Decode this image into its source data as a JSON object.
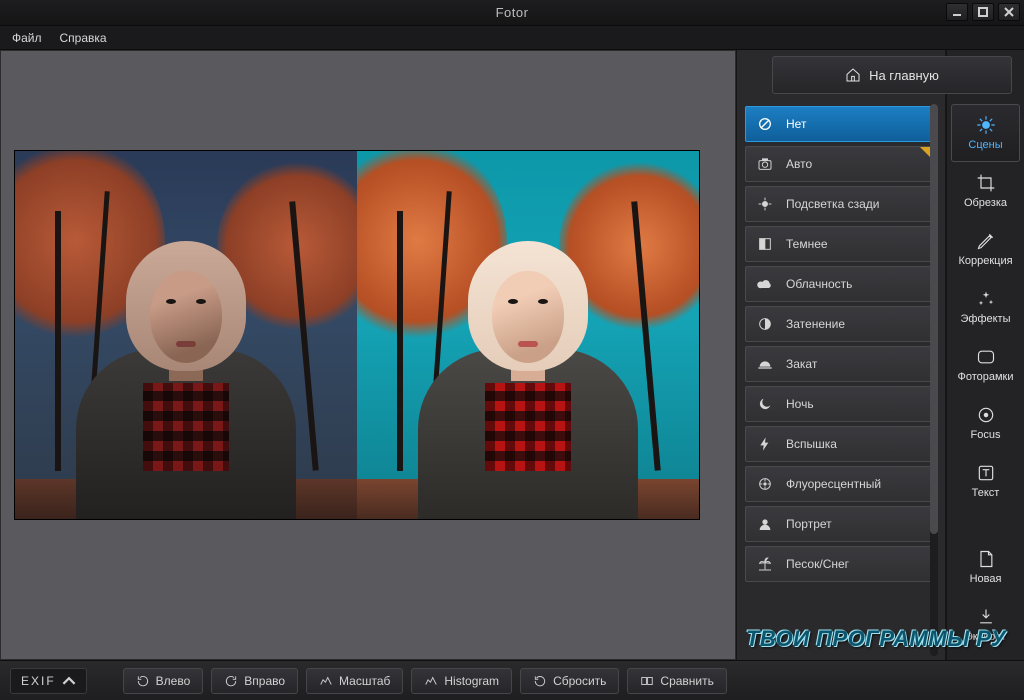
{
  "app": {
    "title": "Fotor"
  },
  "menu": {
    "file": "Файл",
    "help": "Справка"
  },
  "home": {
    "label": "На главную"
  },
  "scenes": {
    "items": [
      {
        "id": "none",
        "label": "Нет",
        "icon": "ban",
        "selected": true
      },
      {
        "id": "auto",
        "label": "Авто",
        "icon": "camera",
        "starred": true
      },
      {
        "id": "backlit",
        "label": "Подсветка сзади",
        "icon": "backlit"
      },
      {
        "id": "darken",
        "label": "Темнее",
        "icon": "darken"
      },
      {
        "id": "cloudy",
        "label": "Облачность",
        "icon": "cloud"
      },
      {
        "id": "shade",
        "label": "Затенение",
        "icon": "shade"
      },
      {
        "id": "sunset",
        "label": "Закат",
        "icon": "sunset"
      },
      {
        "id": "night",
        "label": "Ночь",
        "icon": "moon"
      },
      {
        "id": "flash",
        "label": "Вспышка",
        "icon": "flash"
      },
      {
        "id": "fluor",
        "label": "Флуоресцентный",
        "icon": "fluor"
      },
      {
        "id": "portrait",
        "label": "Портрет",
        "icon": "portrait"
      },
      {
        "id": "sandsnow",
        "label": "Песок/Снег",
        "icon": "palm"
      }
    ]
  },
  "tools": {
    "scenes": "Сцены",
    "crop": "Обрезка",
    "adjust": "Коррекция",
    "effects": "Эффекты",
    "frames": "Фоторамки",
    "focus": "Focus",
    "text": "Текст",
    "new": "Новая",
    "export": "Экспорт"
  },
  "bottom": {
    "exif": "EXIF",
    "left": "Влево",
    "right": "Вправо",
    "zoom": "Масштаб",
    "histogram": "Histogram",
    "reset": "Сбросить",
    "compare": "Сравнить"
  },
  "watermark": "ТВОИ ПРОГРАММЫ РУ"
}
